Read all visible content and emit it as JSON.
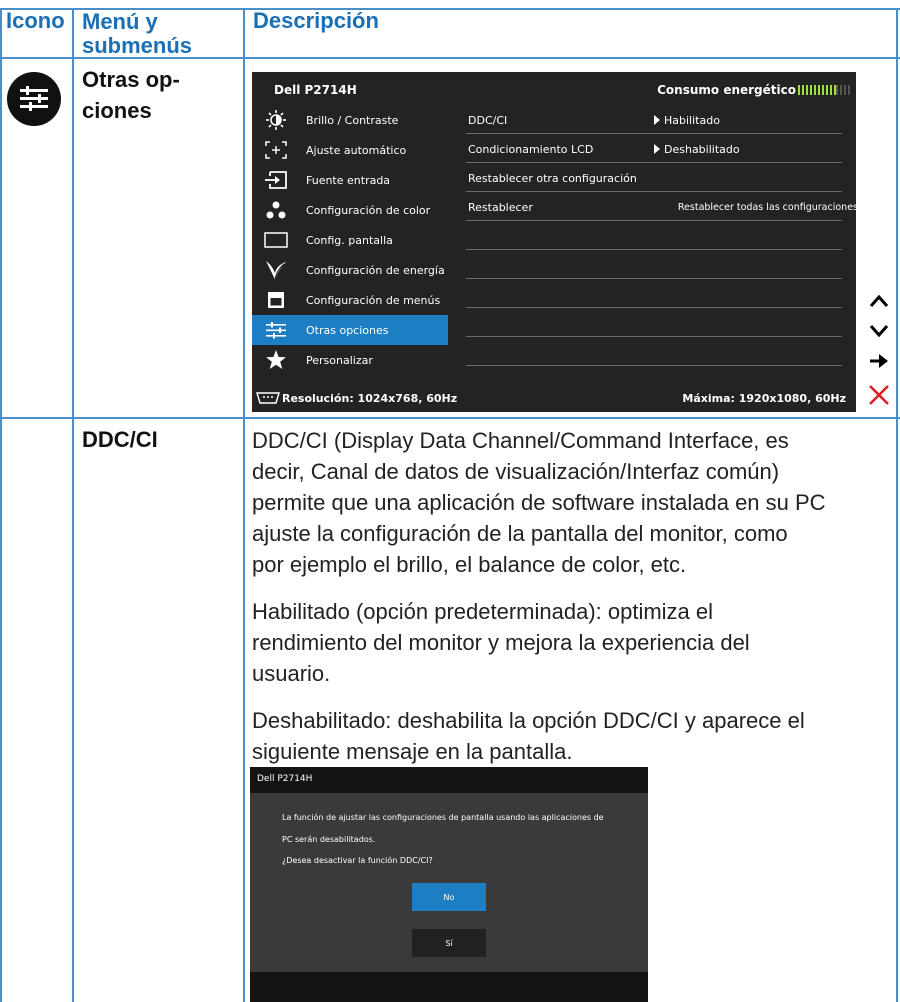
{
  "table": {
    "headers": {
      "icon": "Icono",
      "menu": "Menú y submenús",
      "desc": "Descripción"
    },
    "row1": {
      "title_line1": "Otras op-",
      "title_line2": "ciones",
      "icon": "sliders-icon"
    },
    "row2": {
      "title": "DDC/CI",
      "paragraph1": [
        "DDC/CI (Display Data Channel/Command Interface, es",
        "decir, Canal de datos de visualización/Interfaz común)",
        "permite que una aplicación de software instalada en su PC",
        "ajuste la configuración de la pantalla del monitor, como",
        "por ejemplo el brillo, el balance de color, etc."
      ],
      "paragraph2": [
        "Habilitado (opción predeterminada): optimiza el",
        "rendimiento del monitor y mejora la experiencia del",
        "usuario."
      ],
      "paragraph3": [
        "Deshabilitado: deshabilita la opción DDC/CI y aparece el",
        "siguiente mensaje en la pantalla."
      ]
    }
  },
  "osd": {
    "title": "Dell P2714H",
    "power_label": "Consumo energético",
    "menu": [
      {
        "label": "Brillo / Contraste",
        "icon": "brightness-icon"
      },
      {
        "label": "Ajuste  automático",
        "icon": "auto-adjust-icon"
      },
      {
        "label": "Fuente entrada",
        "icon": "input-source-icon"
      },
      {
        "label": "Configuración de color",
        "icon": "color-dots-icon"
      },
      {
        "label": "Config. pantalla",
        "icon": "display-icon"
      },
      {
        "label": "Configuración de energía",
        "icon": "energy-leaf-icon"
      },
      {
        "label": "Configuración de menús",
        "icon": "menu-window-icon"
      },
      {
        "label": "Otras opciones",
        "icon": "sliders-icon",
        "active": true
      },
      {
        "label": "Personalizar",
        "icon": "star-icon"
      }
    ],
    "options": [
      {
        "key": "DDC/CI",
        "value": "Habilitado"
      },
      {
        "key": "Condicionamiento LCD",
        "value": "Deshabilitado"
      },
      {
        "key": "Restablecer otra configuración",
        "value": ""
      },
      {
        "key": "Restablecer",
        "value": "Restablecer todas las configuraciones"
      }
    ],
    "resolution": "Resolución: 1024x768, 60Hz",
    "max_resolution": "Máxima: 1920x1080, 60Hz"
  },
  "controls": [
    "up-arrow-icon",
    "down-arrow-icon",
    "right-arrow-icon",
    "close-x-icon"
  ],
  "dialog": {
    "title": "Dell P2714H",
    "line1": "La función de ajustar las configuraciones de pantalla usando las aplicaciones de",
    "line2": "PC serán desabilitados.",
    "line3": "¿Desea desactivar la función DDC/CI?",
    "no": "No",
    "yes": "Sí"
  },
  "colors": {
    "rule": "#4a8fc7",
    "header_text": "#1a6fb5",
    "osd_bg": "#232323",
    "highlight": "#1e7ec4",
    "close": "#e02020"
  }
}
